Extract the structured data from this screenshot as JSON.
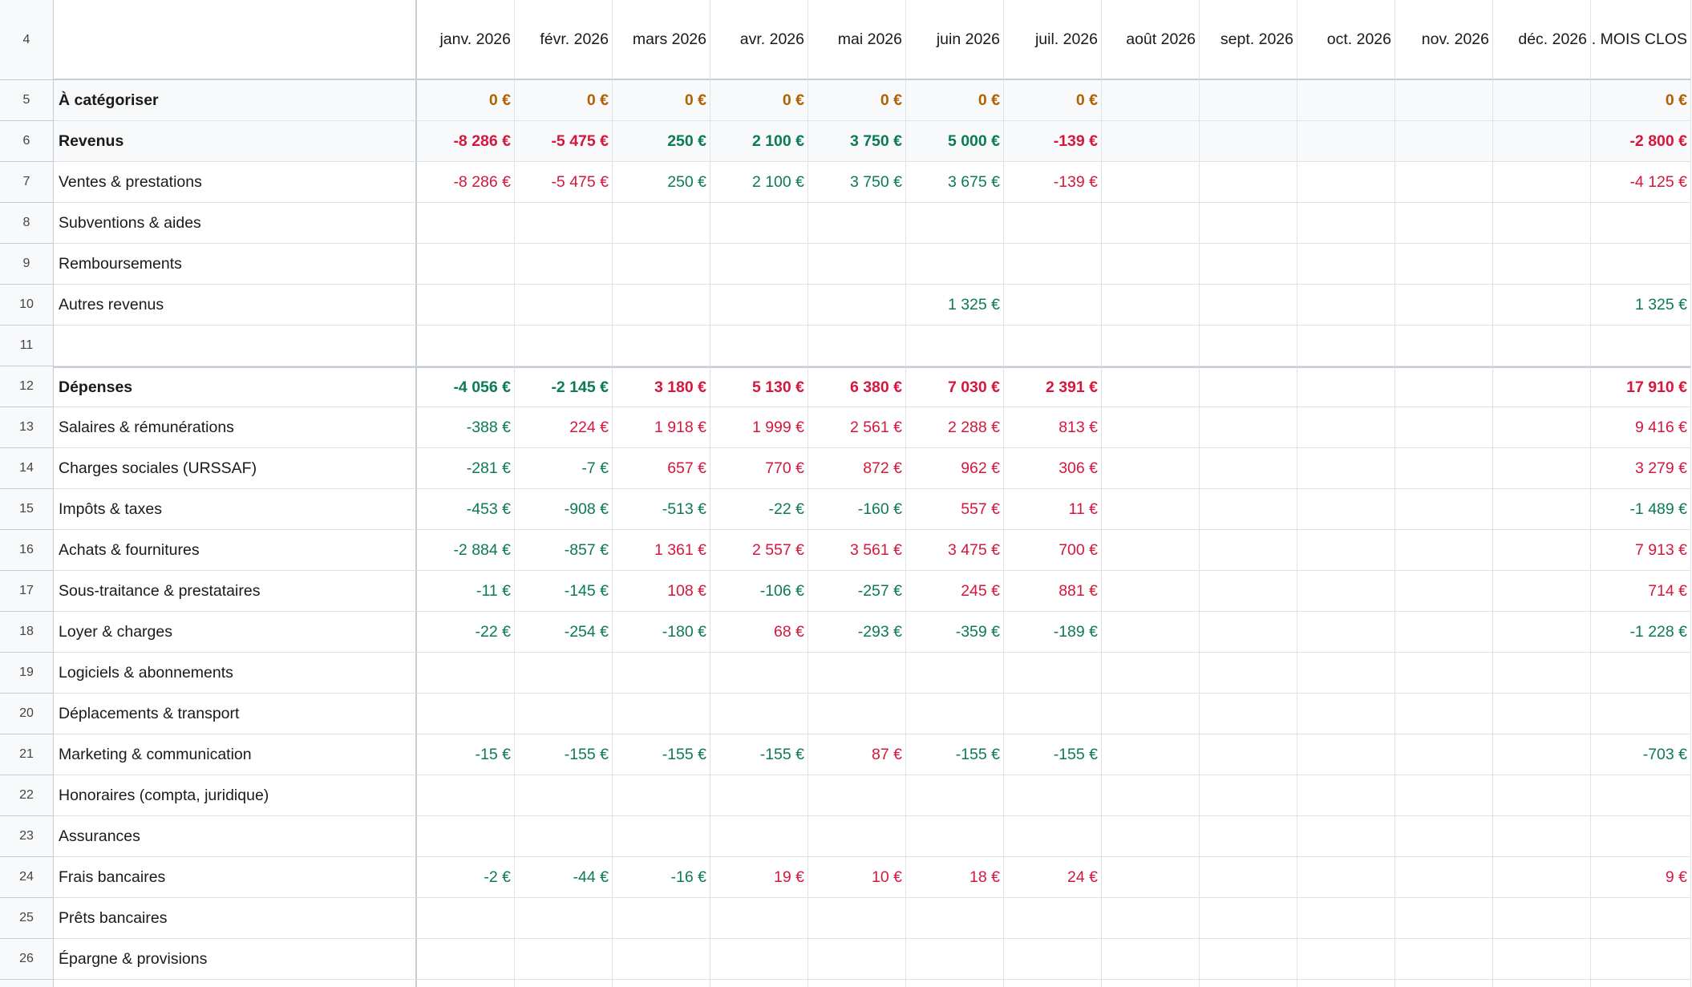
{
  "header_row": {
    "row_number": "4",
    "label": "",
    "months": [
      "janv. 2026",
      "févr. 2026",
      "mars 2026",
      "avr. 2026",
      "mai 2026",
      "juin 2026",
      "juil. 2026",
      "août 2026",
      "sept. 2026",
      "oct. 2026",
      "nov. 2026",
      "déc. 2026",
      ". MOIS CLOS"
    ]
  },
  "colors": {
    "positive": "#0b7a55",
    "negative": "#d6173d",
    "neutral": "#b35f00",
    "text": "#1a1a1a"
  },
  "rows": [
    {
      "n": "5",
      "label": "À catégoriser",
      "style": "bold",
      "tint": true,
      "values": [
        "0 €",
        "0 €",
        "0 €",
        "0 €",
        "0 €",
        "0 €",
        "0 €",
        "",
        "",
        "",
        "",
        "",
        "0 €"
      ],
      "colors": [
        "o",
        "o",
        "o",
        "o",
        "o",
        "o",
        "o",
        "",
        "",
        "",
        "",
        "",
        "o"
      ]
    },
    {
      "n": "6",
      "label": "Revenus",
      "style": "bold",
      "tint": true,
      "values": [
        "-8 286 €",
        "-5 475 €",
        "250 €",
        "2 100 €",
        "3 750 €",
        "5 000 €",
        "-139 €",
        "",
        "",
        "",
        "",
        "",
        "-2 800 €"
      ],
      "colors": [
        "r",
        "r",
        "g",
        "g",
        "g",
        "g",
        "r",
        "",
        "",
        "",
        "",
        "",
        "r"
      ]
    },
    {
      "n": "7",
      "label": "Ventes & prestations",
      "values": [
        "-8 286 €",
        "-5 475 €",
        "250 €",
        "2 100 €",
        "3 750 €",
        "3 675 €",
        "-139 €",
        "",
        "",
        "",
        "",
        "",
        "-4 125 €"
      ],
      "colors": [
        "r",
        "r",
        "g",
        "g",
        "g",
        "g",
        "r",
        "",
        "",
        "",
        "",
        "",
        "r"
      ]
    },
    {
      "n": "8",
      "label": "Subventions & aides",
      "values": [
        "",
        "",
        "",
        "",
        "",
        "",
        "",
        "",
        "",
        "",
        "",
        "",
        ""
      ],
      "colors": []
    },
    {
      "n": "9",
      "label": "Remboursements",
      "values": [
        "",
        "",
        "",
        "",
        "",
        "",
        "",
        "",
        "",
        "",
        "",
        "",
        ""
      ],
      "colors": []
    },
    {
      "n": "10",
      "label": "Autres revenus",
      "values": [
        "",
        "",
        "",
        "",
        "",
        "1 325 €",
        "",
        "",
        "",
        "",
        "",
        "",
        "1 325 €"
      ],
      "colors": [
        "",
        "",
        "",
        "",
        "",
        "g",
        "",
        "",
        "",
        "",
        "",
        "",
        "g"
      ]
    },
    {
      "n": "11",
      "label": "",
      "values": [
        "",
        "",
        "",
        "",
        "",
        "",
        "",
        "",
        "",
        "",
        "",
        "",
        ""
      ],
      "colors": []
    },
    {
      "n": "12",
      "label": "Dépenses",
      "style": "bold",
      "thick": true,
      "values": [
        "-4 056 €",
        "-2 145 €",
        "3 180 €",
        "5 130 €",
        "6 380 €",
        "7 030 €",
        "2 391 €",
        "",
        "",
        "",
        "",
        "",
        "17 910 €"
      ],
      "colors": [
        "g",
        "g",
        "r",
        "r",
        "r",
        "r",
        "r",
        "",
        "",
        "",
        "",
        "",
        "r"
      ]
    },
    {
      "n": "13",
      "label": "Salaires & rémunérations",
      "values": [
        "-388 €",
        "224 €",
        "1 918 €",
        "1 999 €",
        "2 561 €",
        "2 288 €",
        "813 €",
        "",
        "",
        "",
        "",
        "",
        "9 416 €"
      ],
      "colors": [
        "g",
        "r",
        "r",
        "r",
        "r",
        "r",
        "r",
        "",
        "",
        "",
        "",
        "",
        "r"
      ]
    },
    {
      "n": "14",
      "label": "Charges sociales (URSSAF)",
      "values": [
        "-281 €",
        "-7 €",
        "657 €",
        "770 €",
        "872 €",
        "962 €",
        "306 €",
        "",
        "",
        "",
        "",
        "",
        "3 279 €"
      ],
      "colors": [
        "g",
        "g",
        "r",
        "r",
        "r",
        "r",
        "r",
        "",
        "",
        "",
        "",
        "",
        "r"
      ]
    },
    {
      "n": "15",
      "label": "Impôts & taxes",
      "values": [
        "-453 €",
        "-908 €",
        "-513 €",
        "-22 €",
        "-160 €",
        "557 €",
        "11 €",
        "",
        "",
        "",
        "",
        "",
        "-1 489 €"
      ],
      "colors": [
        "g",
        "g",
        "g",
        "g",
        "g",
        "r",
        "r",
        "",
        "",
        "",
        "",
        "",
        "g"
      ]
    },
    {
      "n": "16",
      "label": "Achats & fournitures",
      "values": [
        "-2 884 €",
        "-857 €",
        "1 361 €",
        "2 557 €",
        "3 561 €",
        "3 475 €",
        "700 €",
        "",
        "",
        "",
        "",
        "",
        "7 913 €"
      ],
      "colors": [
        "g",
        "g",
        "r",
        "r",
        "r",
        "r",
        "r",
        "",
        "",
        "",
        "",
        "",
        "r"
      ]
    },
    {
      "n": "17",
      "label": "Sous-traitance & prestataires",
      "values": [
        "-11 €",
        "-145 €",
        "108 €",
        "-106 €",
        "-257 €",
        "245 €",
        "881 €",
        "",
        "",
        "",
        "",
        "",
        "714 €"
      ],
      "colors": [
        "g",
        "g",
        "r",
        "g",
        "g",
        "r",
        "r",
        "",
        "",
        "",
        "",
        "",
        "r"
      ]
    },
    {
      "n": "18",
      "label": "Loyer & charges",
      "values": [
        "-22 €",
        "-254 €",
        "-180 €",
        "68 €",
        "-293 €",
        "-359 €",
        "-189 €",
        "",
        "",
        "",
        "",
        "",
        "-1 228 €"
      ],
      "colors": [
        "g",
        "g",
        "g",
        "r",
        "g",
        "g",
        "g",
        "",
        "",
        "",
        "",
        "",
        "g"
      ]
    },
    {
      "n": "19",
      "label": "Logiciels & abonnements",
      "values": [
        "",
        "",
        "",
        "",
        "",
        "",
        "",
        "",
        "",
        "",
        "",
        "",
        ""
      ],
      "colors": []
    },
    {
      "n": "20",
      "label": "Déplacements & transport",
      "values": [
        "",
        "",
        "",
        "",
        "",
        "",
        "",
        "",
        "",
        "",
        "",
        "",
        ""
      ],
      "colors": []
    },
    {
      "n": "21",
      "label": "Marketing & communication",
      "values": [
        "-15 €",
        "-155 €",
        "-155 €",
        "-155 €",
        "87 €",
        "-155 €",
        "-155 €",
        "",
        "",
        "",
        "",
        "",
        "-703 €"
      ],
      "colors": [
        "g",
        "g",
        "g",
        "g",
        "r",
        "g",
        "g",
        "",
        "",
        "",
        "",
        "",
        "g"
      ]
    },
    {
      "n": "22",
      "label": "Honoraires (compta, juridique)",
      "values": [
        "",
        "",
        "",
        "",
        "",
        "",
        "",
        "",
        "",
        "",
        "",
        "",
        ""
      ],
      "colors": []
    },
    {
      "n": "23",
      "label": "Assurances",
      "values": [
        "",
        "",
        "",
        "",
        "",
        "",
        "",
        "",
        "",
        "",
        "",
        "",
        ""
      ],
      "colors": []
    },
    {
      "n": "24",
      "label": "Frais bancaires",
      "values": [
        "-2 €",
        "-44 €",
        "-16 €",
        "19 €",
        "10 €",
        "18 €",
        "24 €",
        "",
        "",
        "",
        "",
        "",
        "9 €"
      ],
      "colors": [
        "g",
        "g",
        "g",
        "r",
        "r",
        "r",
        "r",
        "",
        "",
        "",
        "",
        "",
        "r"
      ]
    },
    {
      "n": "25",
      "label": "Prêts bancaires",
      "values": [
        "",
        "",
        "",
        "",
        "",
        "",
        "",
        "",
        "",
        "",
        "",
        "",
        ""
      ],
      "colors": []
    },
    {
      "n": "26",
      "label": "Épargne & provisions",
      "values": [
        "",
        "",
        "",
        "",
        "",
        "",
        "",
        "",
        "",
        "",
        "",
        "",
        ""
      ],
      "colors": []
    },
    {
      "n": "",
      "label": "",
      "values": [
        "",
        "",
        "",
        "",
        "",
        "",
        "",
        "",
        "",
        "",
        "",
        "",
        ""
      ],
      "colors": []
    }
  ]
}
